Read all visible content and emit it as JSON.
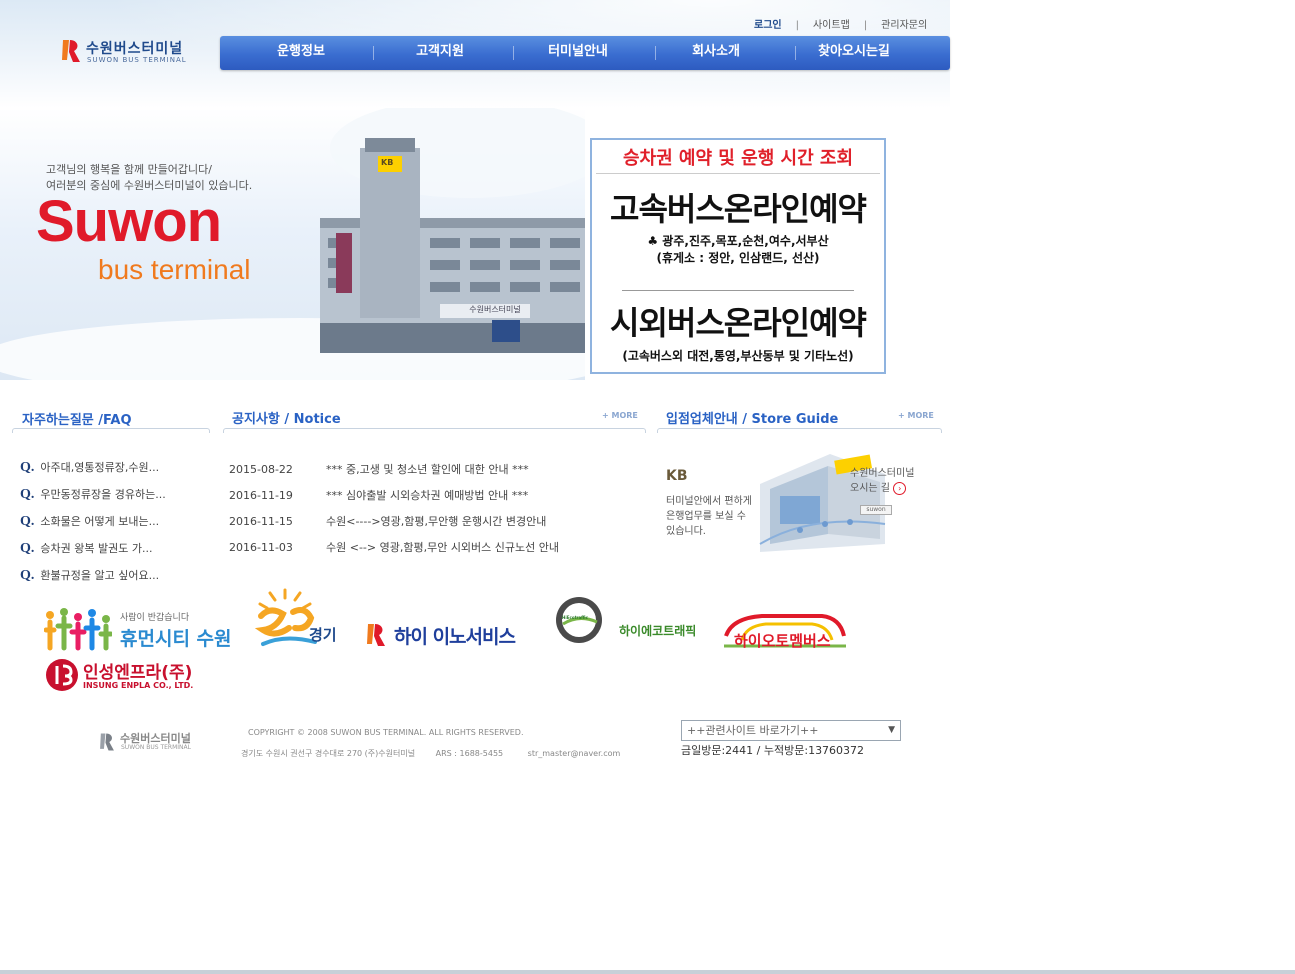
{
  "header": {
    "logo_kr": "수원버스터미널",
    "logo_en": "SUWON BUS TERMINAL",
    "util_links": [
      "로그인",
      "사이트맵",
      "관리자문의"
    ],
    "nav": [
      "운행정보",
      "고객지원",
      "터미널안내",
      "회사소개",
      "찾아오시는길"
    ]
  },
  "hero": {
    "slogan_line1": "고객님의 행복을 함께 만들어갑니다/",
    "slogan_line2": "여러분의 중심에 수원버스터미널이 있습니다.",
    "suwon": "Suwon",
    "bus_terminal": "bus terminal",
    "building_sign": "수원버스터미널",
    "building_kb": "KB"
  },
  "booking": {
    "title": "승차권 예약 및 운행 시간 조회",
    "express": "고속버스온라인예약",
    "express_routes": "♣ 광주,진주,목포,순천,여수,서부산",
    "express_rest": "(휴게소 : 정안, 인삼랜드, 선산)",
    "intercity": "시외버스온라인예약",
    "intercity_note": "(고속버스외 대전,통영,부산동부 및 기타노선)"
  },
  "faq": {
    "title": "자주하는질문 /FAQ",
    "items": [
      "아주대,영통정류장,수원...",
      "우만동정류장을 경유하는...",
      "소화물은 어떻게 보내는...",
      "승차권 왕복 발권도 가...",
      "환불규정을 알고 싶어요..."
    ]
  },
  "notice": {
    "title": "공지사항 / Notice",
    "more": "MORE",
    "rows": [
      {
        "date": "2015-08-22",
        "text": "*** 중,고생 및 청소년 할인에 대한 안내 ***"
      },
      {
        "date": "2016-11-19",
        "text": "*** 심야출발 시외승차권 예매방법 안내 ***"
      },
      {
        "date": "2016-11-15",
        "text": "수원<---->영광,함평,무안행 운행시간 변경안내"
      },
      {
        "date": "2016-11-03",
        "text": "수원 <--> 영광,함평,무안 시외버스 신규노선 안내"
      }
    ]
  },
  "store": {
    "title": "입점업체안내 / Store Guide",
    "more": "MORE",
    "kb": "KB",
    "line1": "터미널안에서 편하게",
    "line2": "은행업무를 보실 수",
    "line3": "있습니다.",
    "side1": "수원버스터미널",
    "side2": "오시는 길",
    "sign": "suwon"
  },
  "partners": {
    "human_small": "사람이 반갑습니다",
    "human": "휴먼시티 수원",
    "gyeonggi": "경기",
    "gyeonggi_brush": "굿모닝",
    "inno": "하이 이노서비스",
    "ecotraffic": "하이에코트래픽",
    "ecotraffic_mark": "HiEcotraffic",
    "autoem": "하이오토멤버스",
    "insung": "인성엔프라(주)",
    "insung_en": "INSUNG ENPLA CO., LTD."
  },
  "footer": {
    "logo_kr": "수원버스터미널",
    "logo_en": "SUWON BUS TERMINAL",
    "copyright": "COPYRIGHT © 2008 SUWON BUS TERMINAL. ALL RIGHTS RESERVED.",
    "address": "경기도 수원시 권선구 경수대로 270   (주)수원터미널",
    "ars": "ARS : 1688-5455",
    "email": "str_master@naver.com",
    "related_sites": "++관련사이트 바로가기++",
    "visits": "금일방문:2441 / 누적방문:13760372"
  },
  "colors": {
    "nav_blue": "#3a6dd0",
    "title_blue": "#2a62c4",
    "suwon_red": "#e01a2a",
    "terminal_orange": "#f07a1e"
  }
}
